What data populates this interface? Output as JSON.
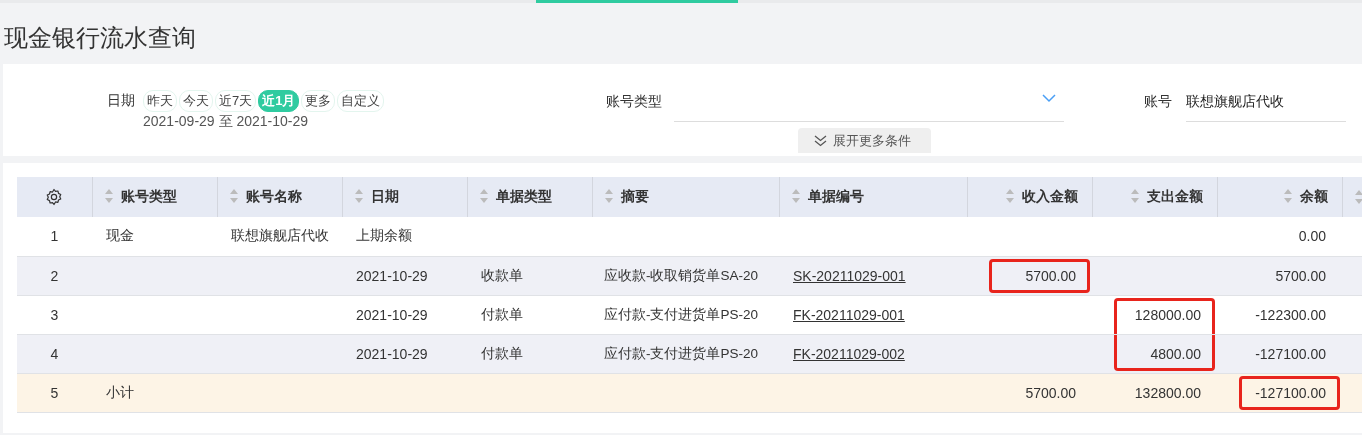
{
  "page_title": "现金银行流水查询",
  "filters": {
    "date_label": "日期",
    "date_presets": [
      {
        "label": "昨天",
        "selected": false
      },
      {
        "label": "今天",
        "selected": false
      },
      {
        "label": "近7天",
        "selected": false
      },
      {
        "label": "近1月",
        "selected": true
      },
      {
        "label": "更多",
        "selected": false
      },
      {
        "label": "自定义",
        "selected": false
      }
    ],
    "date_range": "2021-09-29 至 2021-10-29",
    "account_type_label": "账号类型",
    "account_label": "账号",
    "account_value": "联想旗舰店代收",
    "expand_button": "展开更多条件"
  },
  "table": {
    "columns": [
      "",
      "账号类型",
      "账号名称",
      "日期",
      "单据类型",
      "摘要",
      "单据编号",
      "收入金额",
      "支出金额",
      "余额"
    ],
    "rows": [
      {
        "kind": "normal",
        "cells": [
          "1",
          "现金",
          "联想旗舰店代收",
          "上期余额",
          "",
          "",
          "",
          "",
          "",
          "0.00"
        ],
        "marked": [
          false,
          false,
          false,
          false,
          false,
          false,
          false,
          false,
          false,
          false
        ]
      },
      {
        "kind": "normal",
        "cells": [
          "2",
          "",
          "",
          "2021-10-29",
          "收款单",
          "应收款-收取销货单SA-20",
          "SK-20211029-001",
          "5700.00",
          "",
          "5700.00"
        ],
        "marked": [
          false,
          false,
          false,
          false,
          false,
          false,
          false,
          true,
          false,
          false
        ]
      },
      {
        "kind": "normal",
        "cells": [
          "3",
          "",
          "",
          "2021-10-29",
          "付款单",
          "应付款-支付进货单PS-20",
          "FK-20211029-001",
          "",
          "128000.00",
          "-122300.00"
        ],
        "marked": [
          false,
          false,
          false,
          false,
          false,
          false,
          false,
          false,
          true,
          false
        ]
      },
      {
        "kind": "normal",
        "cells": [
          "4",
          "",
          "",
          "2021-10-29",
          "付款单",
          "应付款-支付进货单PS-20",
          "FK-20211029-002",
          "",
          "4800.00",
          "-127100.00"
        ],
        "marked": [
          false,
          false,
          false,
          false,
          false,
          false,
          false,
          false,
          true,
          false
        ]
      },
      {
        "kind": "subtotal",
        "cells": [
          "5",
          "小计",
          "",
          "",
          "",
          "",
          "",
          "5700.00",
          "132800.00",
          "-127100.00"
        ],
        "marked": [
          false,
          false,
          false,
          false,
          false,
          false,
          false,
          false,
          false,
          true
        ]
      }
    ]
  }
}
